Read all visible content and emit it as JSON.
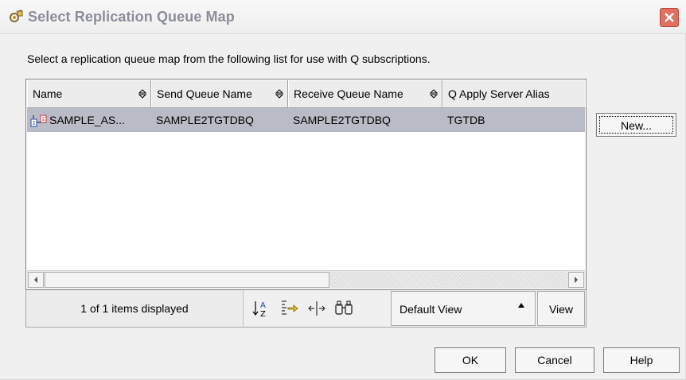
{
  "window": {
    "title": "Select Replication Queue Map",
    "title_icon": "gear-wand-icon",
    "close_icon": "close-icon"
  },
  "instruction": "Select a replication queue map from the following list for use with Q subscriptions.",
  "table": {
    "columns": [
      {
        "label": "Name"
      },
      {
        "label": "Send Queue Name"
      },
      {
        "label": "Receive Queue Name"
      },
      {
        "label": "Q Apply Server Alias"
      }
    ],
    "rows": [
      {
        "name": "SAMPLE_AS...",
        "send_queue": "SAMPLE2TGTDBQ",
        "receive_queue": "SAMPLE2TGTDBQ",
        "apply_alias": "TGTDB",
        "icon": "queue-map-icon",
        "selected": true
      }
    ]
  },
  "status": {
    "items_text": "1 of 1 items displayed"
  },
  "toolbar": {
    "icons": [
      "sort-az-icon",
      "filter-icon",
      "columns-icon",
      "find-icon"
    ],
    "view_select_value": "Default View",
    "view_label": "View"
  },
  "buttons": {
    "new_label": "New...",
    "ok_label": "OK",
    "cancel_label": "Cancel",
    "help_label": "Help"
  },
  "colors": {
    "selected_row": "#b9bcc6",
    "title_text": "#8b8d99",
    "close_button": "#e07060"
  }
}
